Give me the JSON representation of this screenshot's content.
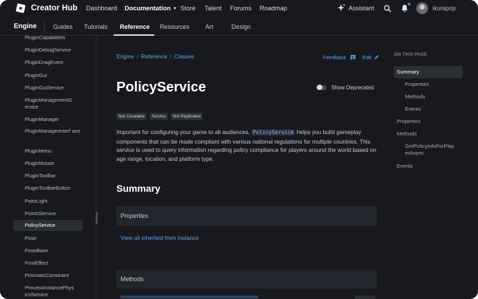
{
  "topbar": {
    "brand": "Creator Hub",
    "nav": [
      "Dashboard",
      "Documentation",
      "Store",
      "Talent",
      "Forums",
      "Roadmap"
    ],
    "assistant": "Assistant",
    "username": "ikurapop"
  },
  "subnav": {
    "engine": "Engine",
    "items": [
      "Guides",
      "Tutorials",
      "Reference",
      "Resources",
      "Art",
      "Design"
    ]
  },
  "sidebar": {
    "items": [
      "PluginCapabilities",
      "PluginDebugService",
      "PluginDragEvent",
      "PluginGui",
      "PluginGuiService",
      "PluginManagementS ervice",
      "PluginManager",
      "PluginManagerInterf ace",
      "PluginMenu",
      "PluginMouse",
      "PluginToolbar",
      "PluginToolbarButton",
      "PointLight",
      "PointsService",
      "PolicyService",
      "Pose",
      "PoseBase",
      "PostEffect",
      "PrismaticConstraint",
      "ProcessInstancePhys icsService"
    ]
  },
  "main": {
    "breadcrumb": [
      "Engine",
      "Reference",
      "Classes"
    ],
    "feedback": "Feedback",
    "edit": "Edit",
    "title": "PolicyService",
    "show_deprecated": "Show Deprecated",
    "badges": [
      "Not Creatable",
      "Service",
      "Not Replicated"
    ],
    "desc_before": "Important for configuring your game to all audiences, ",
    "desc_code": "PolicyService",
    "desc_after": " helps you build gameplay components that can be made compliant with various national regulations for multiple countries. This service is used to query information regarding policy compliance for players around the world based on age range, location, and platform type.",
    "summary": "Summary",
    "properties": "Properties",
    "inherited_link": "View all inherited from Instance",
    "methods": "Methods"
  },
  "toc": {
    "heading": "ON THIS PAGE",
    "summary": "Summary",
    "summary_properties": "Properties",
    "summary_methods": "Methods",
    "summary_events": "Events",
    "properties": "Properties",
    "methods": "Methods",
    "method_1": "GetPolicyInfoForPlay erAsync",
    "events": "Events"
  },
  "colors": {
    "background": "#17191f",
    "link": "#5ea4e8",
    "panel": "#22252b"
  }
}
